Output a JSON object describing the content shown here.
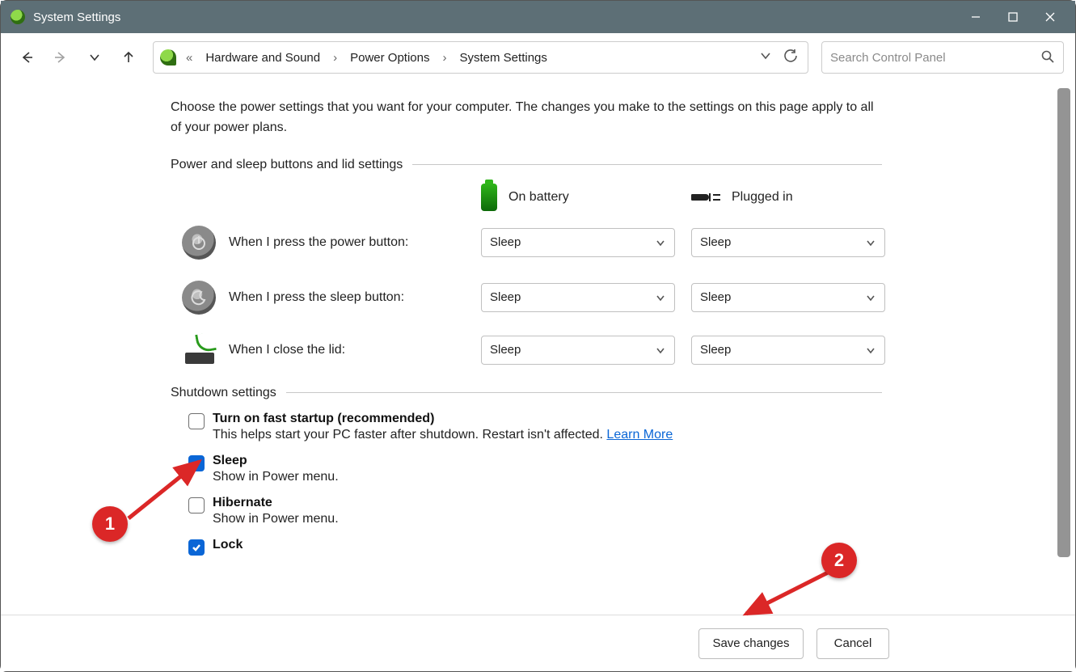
{
  "window": {
    "title": "System Settings"
  },
  "breadcrumb": {
    "items": [
      "Hardware and Sound",
      "Power Options",
      "System Settings"
    ]
  },
  "search": {
    "placeholder": "Search Control Panel"
  },
  "page": {
    "description": "Choose the power settings that you want for your computer. The changes you make to the settings on this page apply to all of your power plans.",
    "section_buttons": "Power and sleep buttons and lid settings",
    "col_battery": "On battery",
    "col_plugged": "Plugged in",
    "rows": [
      {
        "label": "When I press the power button:",
        "battery": "Sleep",
        "plugged": "Sleep"
      },
      {
        "label": "When I press the sleep button:",
        "battery": "Sleep",
        "plugged": "Sleep"
      },
      {
        "label": "When I close the lid:",
        "battery": "Sleep",
        "plugged": "Sleep"
      }
    ],
    "section_shutdown": "Shutdown settings",
    "shutdown": [
      {
        "checked": false,
        "title": "Turn on fast startup (recommended)",
        "desc": "This helps start your PC faster after shutdown. Restart isn't affected. ",
        "link": "Learn More"
      },
      {
        "checked": true,
        "title": "Sleep",
        "desc": "Show in Power menu."
      },
      {
        "checked": false,
        "title": "Hibernate",
        "desc": "Show in Power menu."
      },
      {
        "checked": true,
        "title": "Lock",
        "desc": ""
      }
    ]
  },
  "footer": {
    "save": "Save changes",
    "cancel": "Cancel"
  },
  "annotations": {
    "m1": "1",
    "m2": "2"
  }
}
